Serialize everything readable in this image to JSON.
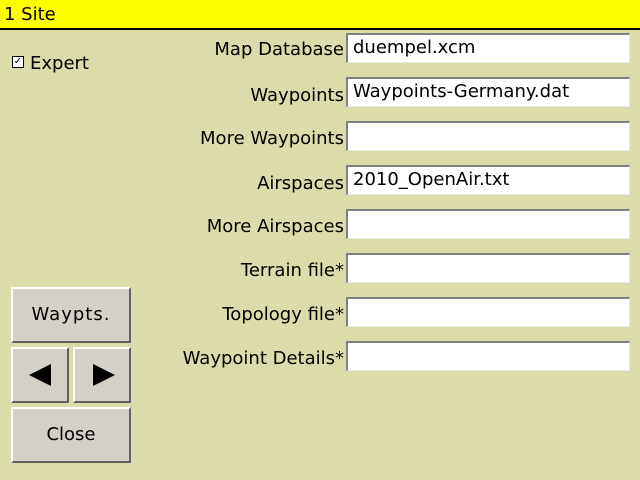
{
  "window": {
    "title": "1 Site"
  },
  "expert": {
    "label": "Expert",
    "checked": true,
    "check_glyph": "☑"
  },
  "fields": {
    "map_database": {
      "label": "Map Database",
      "value": "duempel.xcm"
    },
    "waypoints": {
      "label": "Waypoints",
      "value": "Waypoints-Germany.dat"
    },
    "more_waypoints": {
      "label": "More Waypoints",
      "value": ""
    },
    "airspaces": {
      "label": "Airspaces",
      "value": "2010_OpenAir.txt"
    },
    "more_airspaces": {
      "label": "More Airspaces",
      "value": ""
    },
    "terrain_file": {
      "label": "Terrain file*",
      "value": ""
    },
    "topology_file": {
      "label": "Topology file*",
      "value": ""
    },
    "waypoint_details": {
      "label": "Waypoint Details*",
      "value": ""
    }
  },
  "buttons": {
    "waypts_label": "Waypts.",
    "prev_icon": "left-arrow-icon",
    "next_icon": "right-arrow-icon",
    "close_label": "Close"
  },
  "colors": {
    "title_bar": "#ffff00",
    "background": "#dcdcaa",
    "button_face": "#d4d0c8",
    "field_background": "#ffffff"
  }
}
